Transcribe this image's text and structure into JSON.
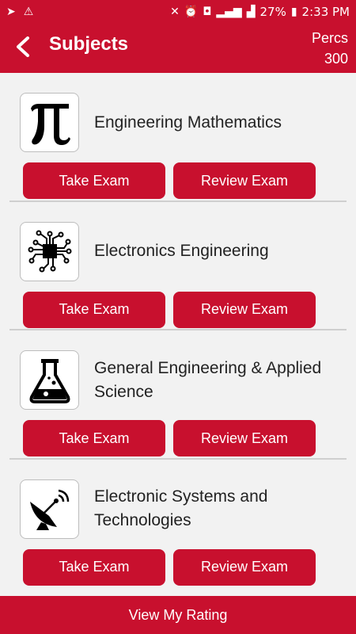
{
  "status_bar": {
    "battery": "27%",
    "time": "2:33 PM"
  },
  "header": {
    "title": "Subjects",
    "percs_label": "Percs",
    "percs_value": "300"
  },
  "subjects": [
    {
      "name": "Engineering Mathematics",
      "icon": "pi-icon",
      "take_label": "Take Exam",
      "review_label": "Review Exam"
    },
    {
      "name": "Electronics Engineering",
      "icon": "circuit-chip-icon",
      "take_label": "Take Exam",
      "review_label": "Review Exam"
    },
    {
      "name": "General Engineering & Applied Science",
      "icon": "flask-icon",
      "take_label": "Take Exam",
      "review_label": "Review Exam"
    },
    {
      "name": "Electronic Systems and Technologies",
      "icon": "satellite-dish-icon",
      "take_label": "Take Exam",
      "review_label": "Review Exam"
    }
  ],
  "footer": {
    "rating_label": "View My Rating"
  },
  "colors": {
    "primary": "#c8102e",
    "background": "#f2f2f2"
  }
}
